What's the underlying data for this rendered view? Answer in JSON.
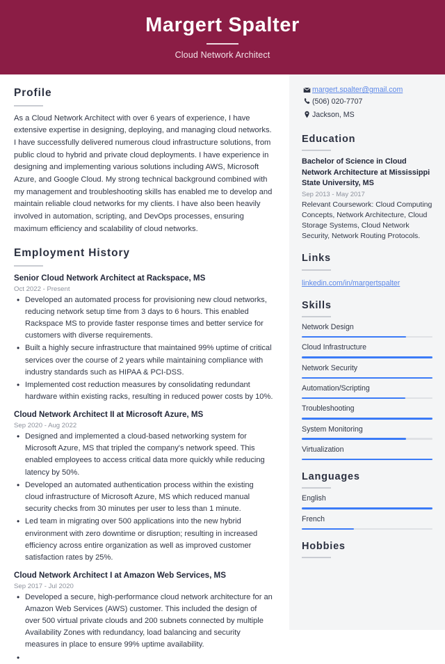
{
  "header": {
    "name": "Margert Spalter",
    "headline": "Cloud Network Architect",
    "bg_color": "#8b1d45"
  },
  "theme": {
    "accent_bar": "#3b7bf7",
    "link_color": "#5b87e8",
    "sidebar_bg": "#f4f5f6",
    "text_color": "#2f3545"
  },
  "profile": {
    "title": "Profile",
    "text": "As a Cloud Network Architect with over 6 years of experience, I have extensive expertise in designing, deploying, and managing cloud networks. I have successfully delivered numerous cloud infrastructure solutions, from public cloud to hybrid and private cloud deployments. I have experience in designing and implementing various solutions including AWS, Microsoft Azure, and Google Cloud. My strong technical background combined with my management and troubleshooting skills has enabled me to develop and maintain reliable cloud networks for my clients. I have also been heavily involved in automation, scripting, and DevOps processes, ensuring maximum efficiency and scalability of cloud networks."
  },
  "employment": {
    "title": "Employment History",
    "jobs": [
      {
        "title": "Senior Cloud Network Architect at Rackspace, MS",
        "dates": "Oct 2022 - Present",
        "bullets": [
          "Developed an automated process for provisioning new cloud networks, reducing network setup time from 3 days to 6 hours. This enabled Rackspace MS to provide faster response times and better service for customers with diverse requirements.",
          "Built a highly secure infrastructure that maintained 99% uptime of critical services over the course of 2 years while maintaining compliance with industry standards such as HIPAA & PCI-DSS.",
          "Implemented cost reduction measures by consolidating redundant hardware within existing racks, resulting in reduced power costs by 10%."
        ]
      },
      {
        "title": "Cloud Network Architect II at Microsoft Azure, MS",
        "dates": "Sep 2020 - Aug 2022",
        "bullets": [
          "Designed and implemented a cloud-based networking system for Microsoft Azure, MS that tripled the company's network speed. This enabled employees to access critical data more quickly while reducing latency by 50%.",
          "Developed an automated authentication process within the existing cloud infrastructure of Microsoft Azure, MS which reduced manual security checks from 30 minutes per user to less than 1 minute.",
          "Led team in migrating over 500 applications into the new hybrid environment with zero downtime or disruption; resulting in increased efficiency across entire organization as well as improved customer satisfaction rates by 25%."
        ]
      },
      {
        "title": "Cloud Network Architect I at Amazon Web Services, MS",
        "dates": "Sep 2017 - Jul 2020",
        "bullets": [
          "Developed a secure, high-performance cloud network architecture for an Amazon Web Services (AWS) customer. This included the design of over 500 virtual private clouds and 200 subnets connected by multiple Availability Zones with redundancy, load balancing and security measures in place to ensure 99% uptime availability.",
          ""
        ]
      }
    ]
  },
  "contact": {
    "email": "margert.spalter@gmail.com",
    "phone": "(506) 020-7707",
    "location": "Jackson, MS",
    "email_icon": "envelope-icon",
    "phone_icon": "phone-icon",
    "location_icon": "location-pin-icon"
  },
  "education": {
    "title": "Education",
    "degree": "Bachelor of Science in Cloud Network Architecture at Mississippi State University, MS",
    "dates": "Sep 2013 - May 2017",
    "coursework": "Relevant Coursework: Cloud Computing Concepts, Network Architecture, Cloud Storage Systems, Cloud Network Security, Network Routing Protocols."
  },
  "links": {
    "title": "Links",
    "items": [
      {
        "label": "linkedin.com/in/margertspalter"
      }
    ]
  },
  "skills": {
    "title": "Skills",
    "items": [
      {
        "label": "Network Design",
        "level": 80
      },
      {
        "label": "Cloud Infrastructure",
        "level": 100
      },
      {
        "label": "Network Security",
        "level": 100
      },
      {
        "label": "Automation/Scripting",
        "level": 79
      },
      {
        "label": "Troubleshooting",
        "level": 100
      },
      {
        "label": "System Monitoring",
        "level": 80
      },
      {
        "label": "Virtualization",
        "level": 100
      }
    ]
  },
  "languages": {
    "title": "Languages",
    "items": [
      {
        "label": "English",
        "level": 100
      },
      {
        "label": "French",
        "level": 40
      }
    ]
  },
  "hobbies": {
    "title": "Hobbies"
  }
}
